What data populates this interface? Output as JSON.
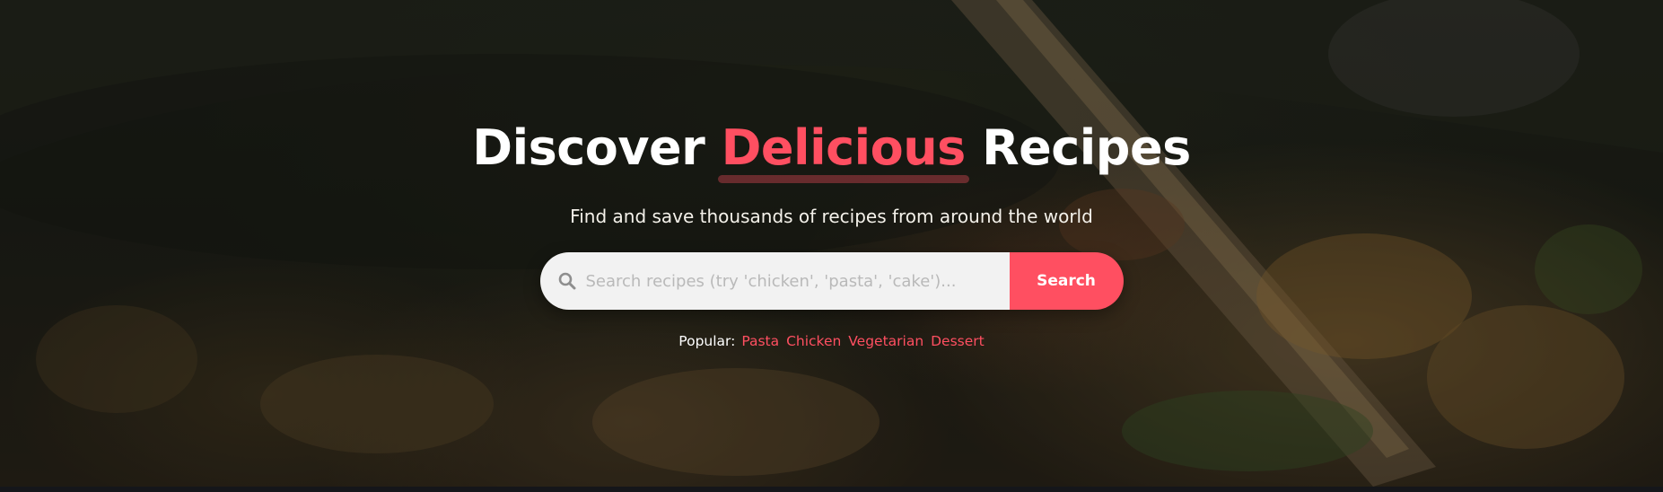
{
  "hero": {
    "title_part1": "Discover ",
    "title_accent": "Delicious",
    "title_part2": " Recipes",
    "subtitle": "Find and save thousands of recipes from around the world"
  },
  "search": {
    "icon": "search-icon",
    "placeholder": "Search recipes (try 'chicken', 'pasta', 'cake')...",
    "value": "",
    "button_label": "Search"
  },
  "popular": {
    "label": "Popular:",
    "tags": [
      "Pasta",
      "Chicken",
      "Vegetarian",
      "Dessert"
    ]
  },
  "colors": {
    "accent": "#ff4f61",
    "title": "#ffffff",
    "search_bg": "#f2f2f2"
  }
}
